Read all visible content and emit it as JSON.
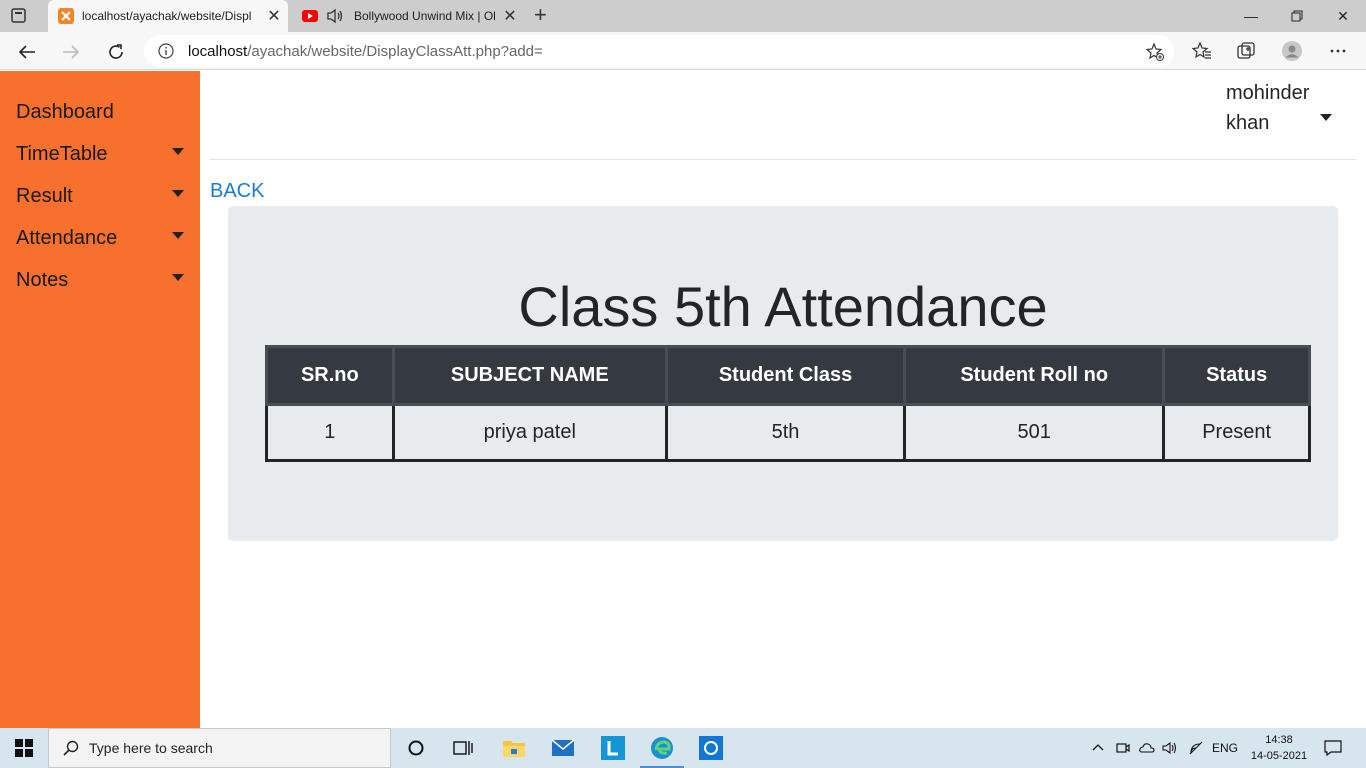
{
  "browser": {
    "tabs": [
      {
        "title": "localhost/ayachak/website/Displ",
        "active": true
      },
      {
        "title": "Bollywood Unwind Mix | Olc",
        "active": false
      }
    ],
    "url_host": "localhost",
    "url_path": "/ayachak/website/DisplayClassAtt.php?add="
  },
  "sidebar": {
    "items": [
      {
        "label": "Dashboard",
        "has_caret": false
      },
      {
        "label": "TimeTable",
        "has_caret": true
      },
      {
        "label": "Result",
        "has_caret": true
      },
      {
        "label": "Attendance",
        "has_caret": true
      },
      {
        "label": "Notes",
        "has_caret": true
      }
    ],
    "background": "#f8702e"
  },
  "user": {
    "first_name": "mohinder",
    "last_name": "khan"
  },
  "back_link": "BACK",
  "page_title": "Class 5th Attendance",
  "table": {
    "headers": [
      "SR.no",
      "SUBJECT NAME",
      "Student Class",
      "Student Roll no",
      "Status"
    ],
    "rows": [
      [
        "1",
        "priya patel",
        "5th",
        "501",
        "Present"
      ]
    ]
  },
  "taskbar": {
    "search_placeholder": "Type here to search",
    "language": "ENG",
    "time": "14:38",
    "date": "14-05-2021"
  },
  "colors": {
    "accent_link": "#1c7cd5",
    "table_header": "#343a40",
    "jumbotron": "#e8ebee"
  }
}
